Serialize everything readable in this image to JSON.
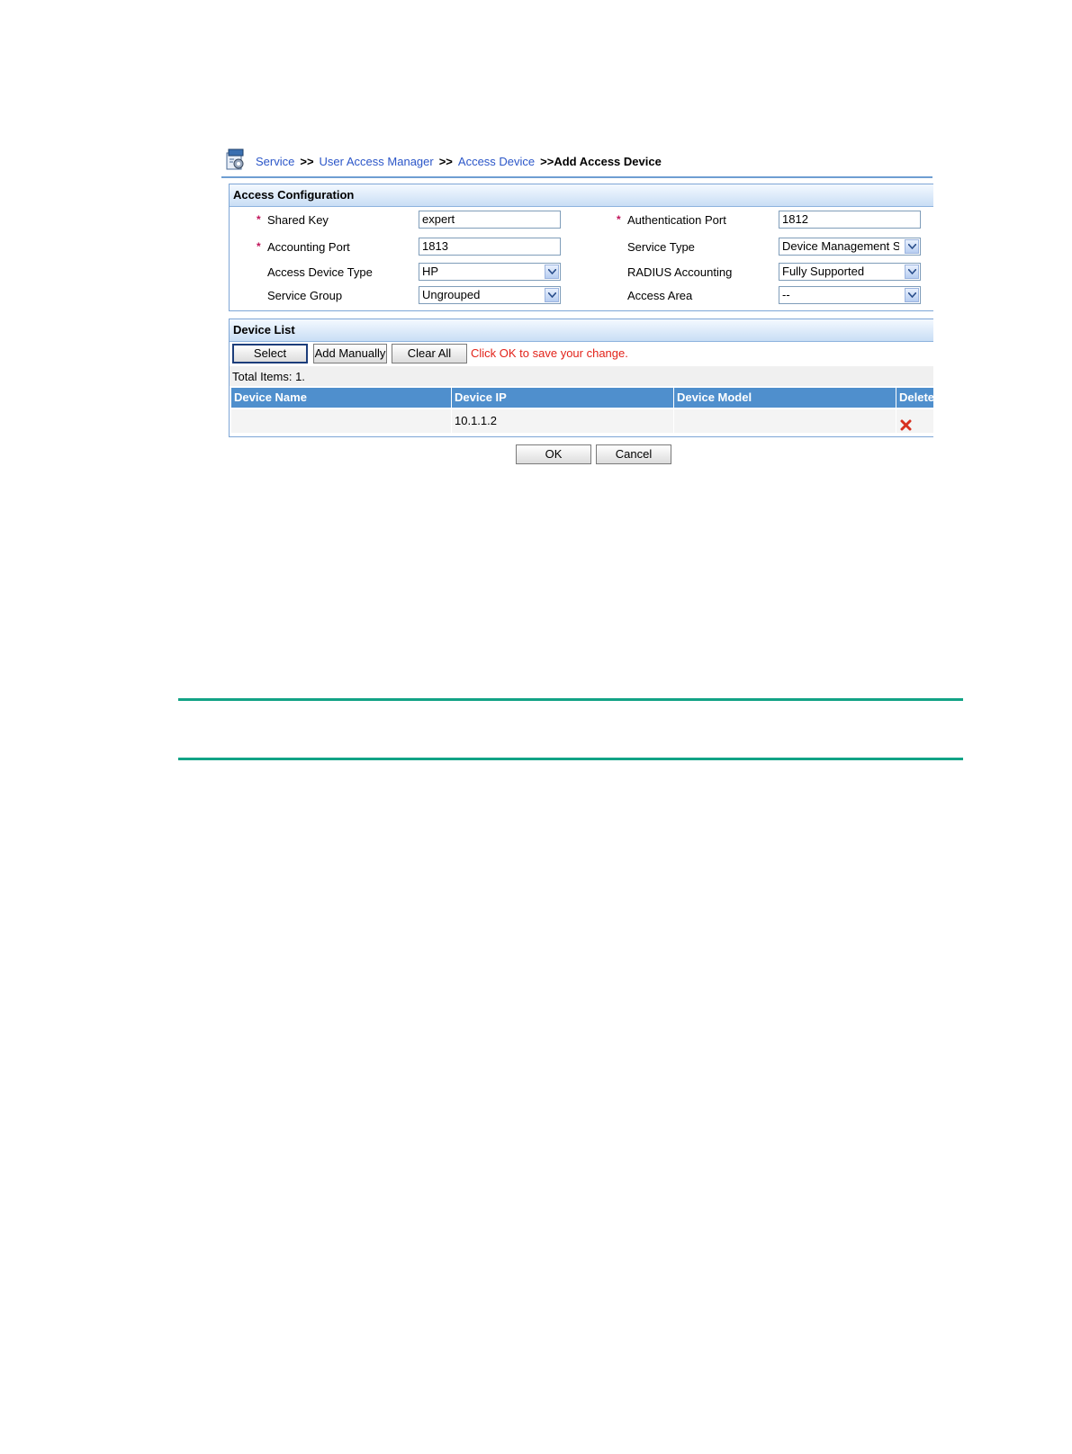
{
  "breadcrumb": {
    "items": [
      "Service",
      "User Access Manager",
      "Access Device"
    ],
    "separator": ">>",
    "current": "Add Access Device"
  },
  "access_config": {
    "title": "Access Configuration",
    "shared_key": {
      "label": "Shared Key",
      "value": "expert",
      "required": true
    },
    "auth_port": {
      "label": "Authentication Port",
      "value": "1812",
      "required": true
    },
    "acct_port": {
      "label": "Accounting Port",
      "value": "1813",
      "required": true
    },
    "service_type": {
      "label": "Service Type",
      "value": "Device Management S"
    },
    "device_type": {
      "label": "Access Device Type",
      "value": "HP"
    },
    "radius_acct": {
      "label": "RADIUS Accounting",
      "value": "Fully Supported"
    },
    "service_group": {
      "label": "Service Group",
      "value": "Ungrouped"
    },
    "access_area": {
      "label": "Access Area",
      "value": "--"
    },
    "required_mark": "*"
  },
  "device_list": {
    "title": "Device List",
    "select_label": "Select",
    "add_manually_label": "Add Manually",
    "clear_all_label": "Clear All",
    "hint": "Click OK to save your change.",
    "total": "Total Items: 1.",
    "columns": [
      "Device Name",
      "Device IP",
      "Device Model",
      "Delete"
    ],
    "rows": [
      {
        "name": "",
        "ip": "10.1.1.2",
        "model": ""
      }
    ]
  },
  "actions": {
    "ok_label": "OK",
    "cancel_label": "Cancel"
  },
  "icons": {
    "breadcrumb": "service-settings-icon",
    "dropdown": "chevron-down-icon",
    "delete": "delete-x-icon"
  },
  "colors": {
    "link": "#2b56c8",
    "header_blue": "#4f8fcd",
    "hint_red": "#e2231a",
    "rule_green": "#12a386"
  }
}
